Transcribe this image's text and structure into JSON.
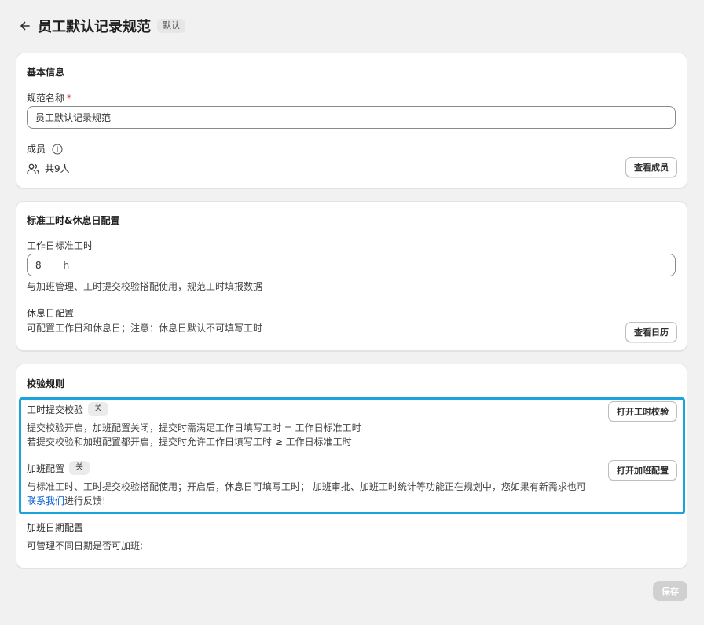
{
  "header": {
    "title": "员工默认记录规范",
    "badge": "默认"
  },
  "basic": {
    "section_title": "基本信息",
    "name_label": "规范名称",
    "required_mark": "*",
    "name_value": "员工默认记录规范",
    "members_label": "成员",
    "members_count": "共9人",
    "view_members_button": "查看成员"
  },
  "standard": {
    "section_title": "标准工时&休息日配置",
    "hours_label": "工作日标准工时",
    "hours_value": "8",
    "hours_unit": "h",
    "hours_help": "与加班管理、工时提交校验搭配使用，规范工时填报数据",
    "rest_label": "休息日配置",
    "rest_help": "可配置工作日和休息日；注意：休息日默认不可填写工时",
    "view_calendar_button": "查看日历"
  },
  "rules": {
    "section_title": "校验规则",
    "submit_check": {
      "label": "工时提交校验",
      "status": "关",
      "desc_line1": "提交校验开启，加班配置关闭，提交时需满足工作日填写工时 = 工作日标准工时",
      "desc_line2": "若提交校验和加班配置都开启，提交时允许工作日填写工时 ≥ 工作日标准工时",
      "button": "打开工时校验"
    },
    "overtime": {
      "label": "加班配置",
      "status": "关",
      "desc_line1": "与标准工时、工时提交校验搭配使用；开启后，休息日可填写工时； 加班审批、加班工时统计等功能正在规划中，您如果有新需求也可",
      "link_text": "联系我们",
      "desc_tail": "进行反馈!",
      "button": "打开加班配置"
    },
    "overtime_date": {
      "label": "加班日期配置",
      "desc": "可管理不同日期是否可加班;"
    }
  },
  "footer": {
    "save_button": "保存"
  },
  "colors": {
    "highlight": "#1aa3dc",
    "link": "#005bd3",
    "save_disabled": "#d0d0d0"
  }
}
